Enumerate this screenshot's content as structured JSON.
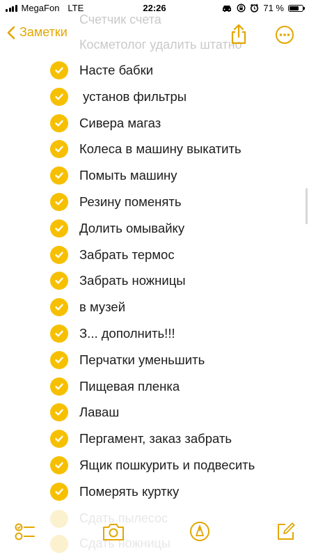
{
  "status": {
    "carrier": "MegaFon",
    "network": "LTE",
    "time": "22:26",
    "battery": "71 %",
    "battery_level": 0.71
  },
  "nav": {
    "back_label": "Заметки",
    "ghost_top": "Счетчик счета",
    "ghost_second": "Косметолог удалить штатно"
  },
  "items": [
    {
      "label": "Насте бабки"
    },
    {
      "label": " установ фильтры"
    },
    {
      "label": "Сивера магаз"
    },
    {
      "label": "Колеса в машину выкатить"
    },
    {
      "label": "Помыть машину"
    },
    {
      "label": "Резину поменять"
    },
    {
      "label": "Долить омывайку"
    },
    {
      "label": "Забрать термос"
    },
    {
      "label": "Забрать ножницы"
    },
    {
      "label": "в музей"
    },
    {
      "label": "З... дополнить!!!"
    },
    {
      "label": "Перчатки уменьшить"
    },
    {
      "label": "Пищевая пленка"
    },
    {
      "label": "Лаваш"
    },
    {
      "label": "Пергамент, заказ забрать"
    },
    {
      "label": "Ящик пошкурить и подвесить"
    },
    {
      "label": "Померять куртку"
    }
  ],
  "ghost_items": [
    {
      "label": "Сдать пылесос"
    },
    {
      "label": "Сдать ножницы"
    }
  ],
  "colors": {
    "accent": "#f6c000",
    "accent_text": "#e3a600"
  }
}
